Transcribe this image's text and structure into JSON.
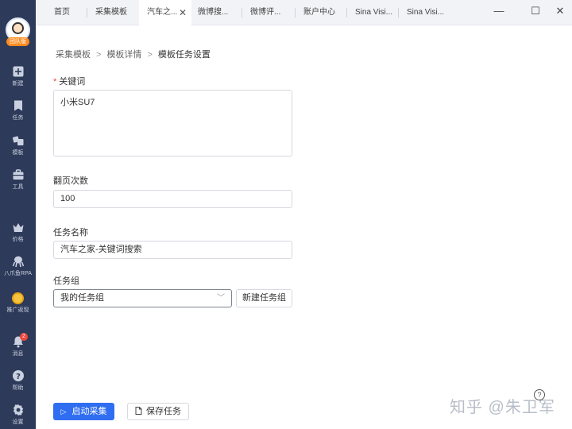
{
  "sidebar": {
    "team_badge": "团队版",
    "items": [
      {
        "label": "新建",
        "icon": "plus-square-icon"
      },
      {
        "label": "任务",
        "icon": "bookmark-icon"
      },
      {
        "label": "模板",
        "icon": "template-icon"
      },
      {
        "label": "工具",
        "icon": "toolbox-icon"
      },
      {
        "label": "价格",
        "icon": "crown-icon"
      },
      {
        "label": "八爪鱼RPA",
        "icon": "octopus-icon"
      },
      {
        "label": "推广返现",
        "icon": "gold-coin-icon"
      },
      {
        "label": "消息",
        "icon": "bell-icon",
        "badge": "2"
      },
      {
        "label": "帮助",
        "icon": "help-icon"
      },
      {
        "label": "设置",
        "icon": "gear-icon"
      }
    ]
  },
  "tabs": [
    {
      "label": "首页"
    },
    {
      "label": "采集模板"
    },
    {
      "label": "汽车之..."
    },
    {
      "label": "微博搜..."
    },
    {
      "label": "微博评..."
    },
    {
      "label": "账户中心"
    },
    {
      "label": "Sina Visi..."
    },
    {
      "label": "Sina Visi..."
    }
  ],
  "window_controls": {
    "minimize": "—",
    "maximize": "☐",
    "close": "✕"
  },
  "breadcrumb": [
    "采集模板",
    "模板详情",
    "模板任务设置"
  ],
  "form": {
    "keyword_label": "关键词",
    "keyword_value": "小米SU7",
    "pages_label": "翻页次数",
    "pages_value": "100",
    "task_name_label": "任务名称",
    "task_name_value": "汽车之家-关键词搜索",
    "group_label": "任务组",
    "group_value": "我的任务组",
    "new_group_button": "新建任务组"
  },
  "actions": {
    "start_button": "启动采集",
    "save_button": "保存任务"
  },
  "watermark": "知乎 @朱卫军",
  "colors": {
    "sidebar": "#2e3a59",
    "accent": "#2f6ef0",
    "required": "#f0463c"
  }
}
